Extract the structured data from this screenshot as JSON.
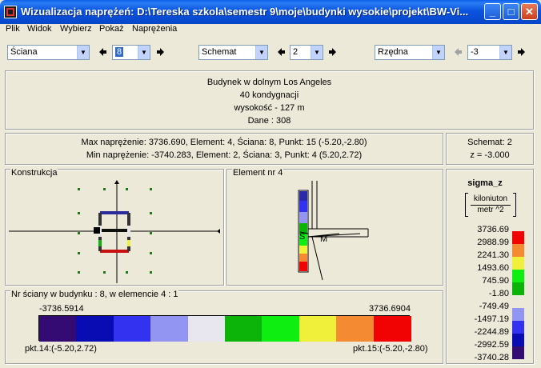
{
  "window": {
    "title": "Wizualizacja naprężeń: D:\\Tereska szkola\\semestr 9\\moje\\budynki wysokie\\projekt\\BW-Vi...",
    "minimize": "_",
    "maximize": "□",
    "close": "✕"
  },
  "menu": [
    "Plik",
    "Widok",
    "Wybierz",
    "Pokaż",
    "Naprężenia"
  ],
  "toolbar": {
    "element_type": "Ściana",
    "element_number": "8",
    "schemat_label": "Schemat",
    "schemat_value": "2",
    "rzedna_label": "Rzędna",
    "rzedna_value": "-3",
    "prev": "◆",
    "next": "◆"
  },
  "building": {
    "name": "Budynek w dolnym Los Angeles",
    "floors": "40 kondygnacji",
    "height": "wysokość - 127 m",
    "data": "Dane :   308"
  },
  "stress": {
    "max_line": "Max naprężenie: 3736.690,   Element: 4,   Ściana: 8,   Punkt: 15 (-5.20,-2.80)",
    "min_line": "Min naprężenie: -3740.283,   Element: 2,   Ściana: 3,   Punkt: 4 (5.20,2.72)",
    "schemat": "Schemat: 2",
    "z": "z = -3.000"
  },
  "konstrukcja": {
    "title": "Konstrukcja"
  },
  "element": {
    "title": "Element nr 4",
    "point_s": "S",
    "point_m": "M"
  },
  "wall": {
    "title": "Nr ściany w budynku :  8,   w elemencie 4 :  1",
    "min_value": "-3736.5914",
    "max_value": "3736.6904",
    "left_point": "pkt.14:(-5.20,2.72)",
    "right_point": "pkt.15:(-5.20,-2.80)",
    "bar_colors": [
      "#330b72",
      "#0a0cb3",
      "#3232f0",
      "#9296f2",
      "#e8e6ee",
      "#0cb40a",
      "#0eef11",
      "#f0f03a",
      "#f48a32",
      "#f20303"
    ]
  },
  "legend": {
    "title": "sigma_z",
    "unit_top": "kiloniuton",
    "unit_bottom": "metr ^2",
    "values": [
      "3736.69",
      "2988.99",
      "2241.30",
      "1493.60",
      "745.90",
      "-1.80",
      "-749.49",
      "-1497.19",
      "-2244.89",
      "-2992.59",
      "-3740.28"
    ],
    "colors": [
      "#f20303",
      "#f48a32",
      "#f0f03a",
      "#0eef11",
      "#0cb40a",
      "#9296f2",
      "#3232f0",
      "#0a0cb3",
      "#330b72"
    ]
  }
}
